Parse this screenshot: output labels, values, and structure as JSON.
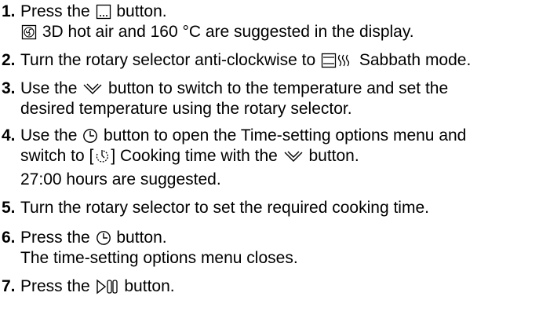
{
  "steps": [
    {
      "number": "1.",
      "lines": [
        {
          "a": "Press the ",
          "icon": "menu-button-icon",
          "b": " button."
        },
        {
          "icon": "hot-air-fan-icon",
          "b": " 3D hot air and 160 °C are suggested in the display."
        }
      ]
    },
    {
      "number": "2.",
      "lines": [
        {
          "a": "Turn the rotary selector anti-clockwise to ",
          "icon": "sabbath-mode-icon",
          "b": " Sabbath mode."
        }
      ]
    },
    {
      "number": "3.",
      "lines": [
        {
          "a": "Use the ",
          "icon": "chevron-down-icon",
          "b": " button to switch to the temperature and set the"
        },
        {
          "a": "desired temperature using the rotary selector."
        }
      ]
    },
    {
      "number": "4.",
      "lines": [
        {
          "a": "Use the ",
          "icon": "clock-icon",
          "b": " button to open the Time-setting options menu and"
        },
        {
          "a": "switch to [",
          "icon": "cooking-time-icon",
          "b": "] Cooking time with the ",
          "icon2": "chevron-down-icon",
          "c": " button."
        },
        {
          "a": "27:00 hours are suggested."
        }
      ]
    },
    {
      "number": "5.",
      "lines": [
        {
          "a": "Turn the rotary selector to set the required cooking time."
        }
      ]
    },
    {
      "number": "6.",
      "lines": [
        {
          "a": "Press the ",
          "icon": "clock-icon",
          "b": " button."
        },
        {
          "a": "The time-setting options menu closes."
        }
      ]
    },
    {
      "number": "7.",
      "lines": [
        {
          "a": "Press the ",
          "icon": "start-pause-icon",
          "b": " button."
        }
      ]
    }
  ]
}
